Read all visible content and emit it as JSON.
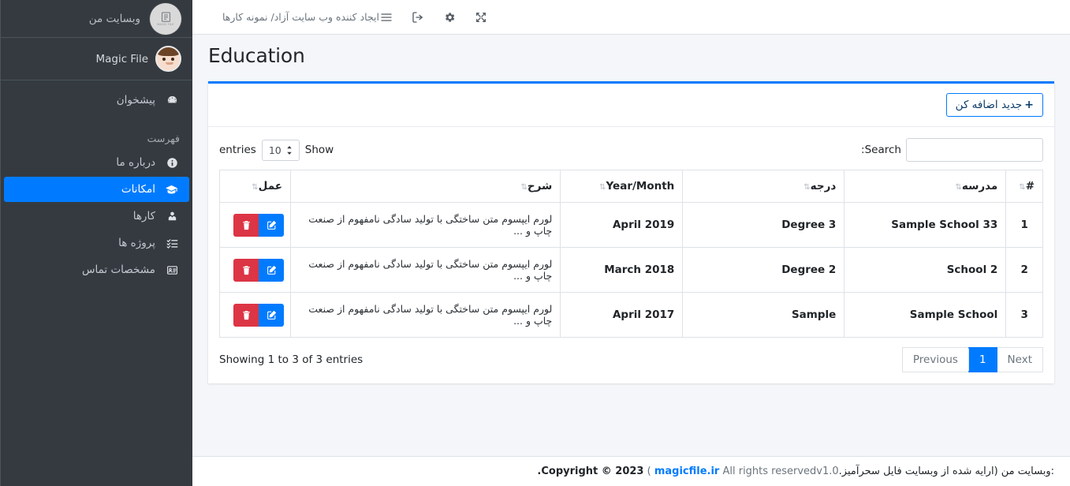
{
  "sidebar": {
    "brand_title": "وبسایت من",
    "brand_logo_icon": "book-logo-icon",
    "brand_logo_text": "MAGIC FILE",
    "user_name": "Magic File",
    "nav_header": "فهرست",
    "items": [
      {
        "label": "پیشخوان",
        "icon": "dashboard-gauge-icon",
        "active": false
      },
      {
        "label": "درباره ما",
        "icon": "info-circle-icon",
        "active": false
      },
      {
        "label": "امکانات",
        "icon": "graduation-cap-icon",
        "active": true
      },
      {
        "label": "کارها",
        "icon": "user-tie-icon",
        "active": false
      },
      {
        "label": "پروژه ها",
        "icon": "tasks-list-icon",
        "active": false
      },
      {
        "label": "مشخصات تماس",
        "icon": "id-card-icon",
        "active": false
      }
    ]
  },
  "topbar": {
    "title": "ایجاد کننده وب سایت آزاد/ نمونه کارها",
    "icons": [
      {
        "name": "hamburger-menu-icon"
      },
      {
        "name": "logout-icon"
      },
      {
        "name": "gear-icon"
      },
      {
        "name": "fullscreen-expand-icon"
      }
    ]
  },
  "page": {
    "title": "Education"
  },
  "card": {
    "add_button_label": "جدید اضافه کن",
    "add_button_plus": "+"
  },
  "datatable": {
    "show_label": "Show",
    "entries_label": "entries",
    "page_length": "10",
    "search_label": "Search:",
    "search_value": "",
    "search_placeholder": "",
    "columns": [
      {
        "label": "#",
        "key": "num"
      },
      {
        "label": "مدرسه",
        "key": "school"
      },
      {
        "label": "درجه",
        "key": "degree"
      },
      {
        "label": "Year/Month",
        "key": "ym"
      },
      {
        "label": "شرح",
        "key": "desc"
      },
      {
        "label": "عمل",
        "key": "action"
      }
    ],
    "sort_icon": "⇅",
    "rows": [
      {
        "num": "1",
        "school": "Sample School 33",
        "degree": "Degree 3",
        "ym": "April 2019",
        "desc": "لورم ایپسوم متن ساختگی با تولید سادگی نامفهوم از صنعت چاپ و ...",
        "delete_icon": "trash-icon",
        "edit_icon": "edit-pencil-square-icon"
      },
      {
        "num": "2",
        "school": "School 2",
        "degree": "Degree 2",
        "ym": "March 2018",
        "desc": "لورم ایپسوم متن ساختگی با تولید سادگی نامفهوم از صنعت چاپ و ...",
        "delete_icon": "trash-icon",
        "edit_icon": "edit-pencil-square-icon"
      },
      {
        "num": "3",
        "school": "Sample School",
        "degree": "Sample",
        "ym": "April 2017",
        "desc": "لورم ایپسوم متن ساختگی با تولید سادگی نامفهوم از صنعت چاپ و ...",
        "delete_icon": "trash-icon",
        "edit_icon": "edit-pencil-square-icon"
      }
    ],
    "info": "Showing 1 to 3 of 3 entries",
    "pagination": {
      "previous": "Previous",
      "next": "Next",
      "pages": [
        "1"
      ],
      "active_page": "1"
    }
  },
  "footer": {
    "copyright_bold": "Copyright © 2023.",
    "rights": " All rights reservedv1.0 ) ",
    "link": "magicfile.ir",
    "suffix": " :وبسایت من (ارایه شده از وبسایت فایل سحرآمیز."
  },
  "colors": {
    "accent": "#007bff",
    "danger": "#dc3545",
    "sidebar_bg": "#343a40",
    "body_bg": "#f4f6f9"
  }
}
